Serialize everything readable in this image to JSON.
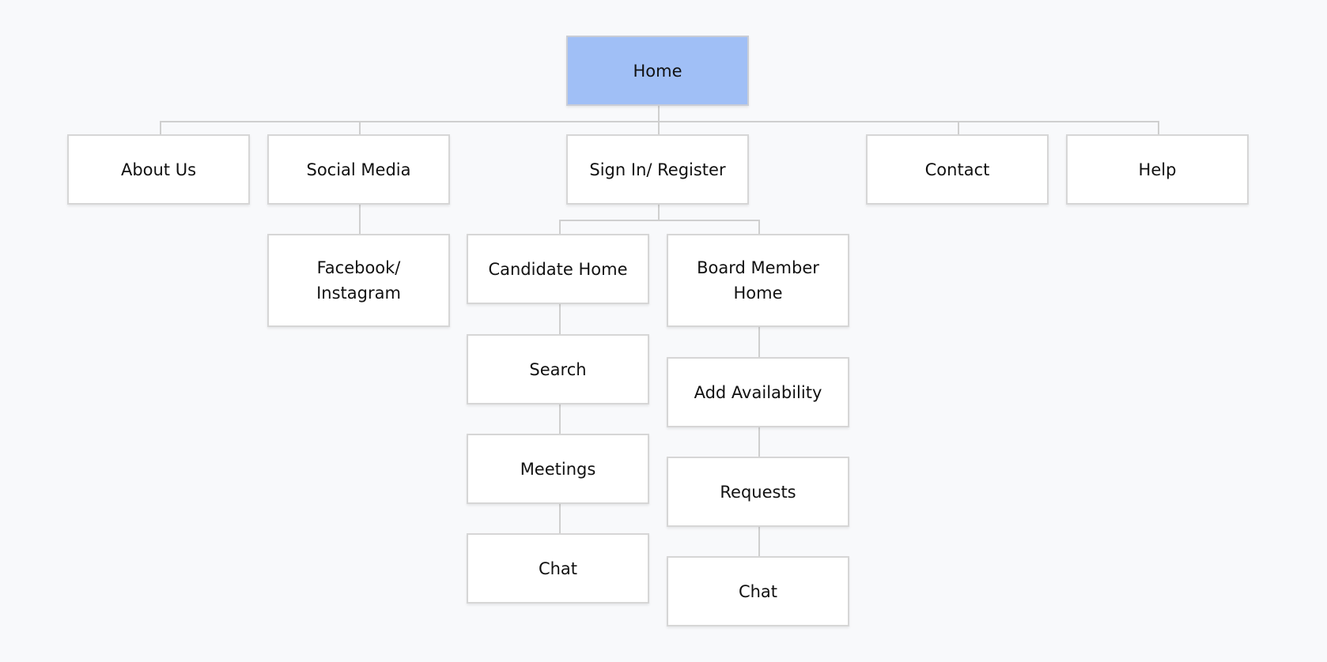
{
  "colors": {
    "root_fill": "#a0bff6",
    "node_fill": "#ffffff",
    "connector": "#cfcfcf",
    "background": "#f8f9fb"
  },
  "nodes": {
    "home": "Home",
    "about": "About Us",
    "social": "Social Media",
    "signin": "Sign In/ Register",
    "contact": "Contact",
    "help": "Help",
    "facebook": "Facebook/ Instagram",
    "candidate_home": "Candidate Home",
    "search": "Search",
    "meetings": "Meetings",
    "candidate_chat": "Chat",
    "board_home": "Board Member Home",
    "availability": "Add Availability",
    "requests": "Requests",
    "board_chat": "Chat"
  }
}
